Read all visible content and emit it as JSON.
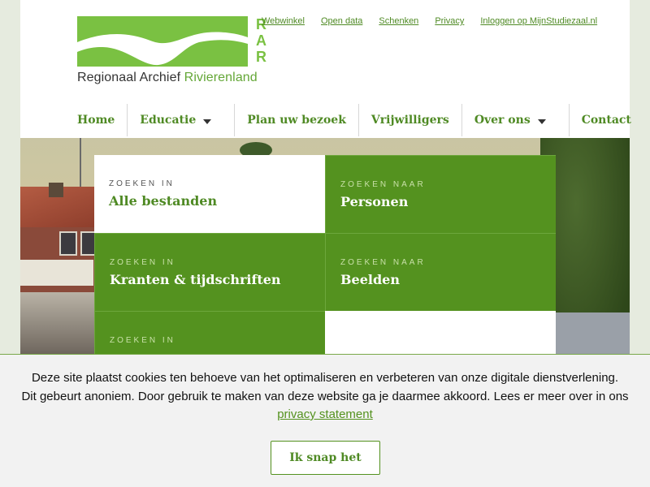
{
  "logo": {
    "name_dark": "Regionaal Archief ",
    "name_green": "Rivierenland",
    "letters": [
      "R",
      "A",
      "R"
    ]
  },
  "toplinks": [
    "Webwinkel",
    "Open data",
    "Schenken",
    "Privacy",
    "Inloggen op MijnStudiezaal.nl"
  ],
  "nav": [
    {
      "label": "Home",
      "dropdown": false
    },
    {
      "label": "Educatie",
      "dropdown": true
    },
    {
      "label": "Plan uw bezoek",
      "dropdown": false
    },
    {
      "label": "Vrijwilligers",
      "dropdown": false
    },
    {
      "label": "Over ons",
      "dropdown": true
    },
    {
      "label": "Contact",
      "dropdown": false
    }
  ],
  "tiles": [
    {
      "kicker": "Zoeken in",
      "title": "Alle bestanden",
      "style": "white"
    },
    {
      "kicker": "Zoeken naar",
      "title": "Personen",
      "style": "green"
    },
    {
      "kicker": "Zoeken in",
      "title": "Kranten & tijdschriften",
      "style": "green"
    },
    {
      "kicker": "Zoeken naar",
      "title": "Beelden",
      "style": "green"
    },
    {
      "kicker": "Zoeken in",
      "title": "",
      "style": "green"
    },
    {
      "kicker": "",
      "title": "",
      "style": "white"
    }
  ],
  "cookie": {
    "line1": "Deze site plaatst cookies ten behoeve van het optimaliseren en verbeteren van onze digitale dienstverlening.",
    "line2": "Dit gebeurt anoniem. Door gebruik te maken van deze website ga je daarmee akkoord. Lees er meer over in ons",
    "link": "privacy statement",
    "button": "Ik snap het"
  },
  "colors": {
    "brand_green": "#54921f",
    "logo_green": "#7ac142",
    "link_green": "#4f8a24"
  }
}
